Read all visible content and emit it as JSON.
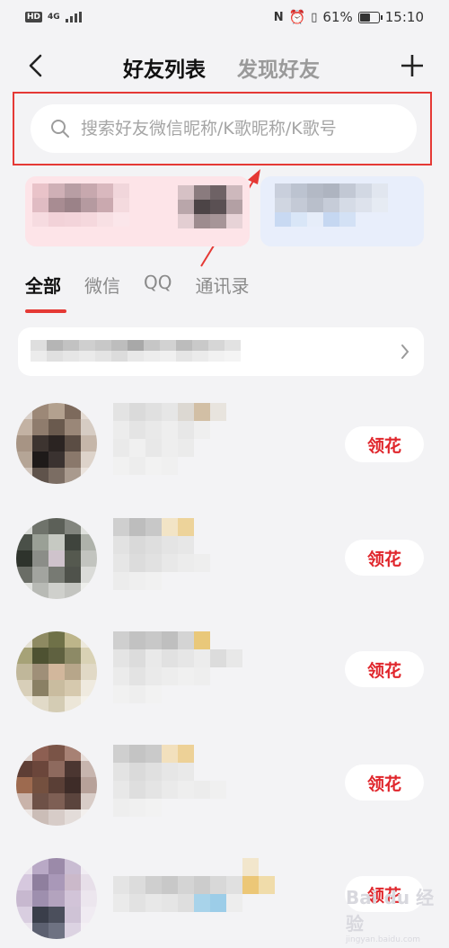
{
  "status_bar": {
    "network": "4G",
    "battery_percent": "61%",
    "battery_level": 0.61,
    "time": "15:10"
  },
  "nav": {
    "tab_friend_list": "好友列表",
    "tab_discover": "发现好友"
  },
  "search": {
    "placeholder": "搜索好友微信昵称/K歌昵称/K歌号"
  },
  "filter_tabs": [
    "全部",
    "微信",
    "QQ",
    "通讯录"
  ],
  "friends": [
    {
      "action": "领花"
    },
    {
      "action": "领花"
    },
    {
      "action": "领花"
    },
    {
      "action": "领花"
    },
    {
      "action": "领花"
    }
  ],
  "watermark": {
    "brand": "Bai du 经验",
    "url": "jingyan.baidu.com"
  },
  "colors": {
    "accent": "#e53935",
    "background": "#f3f3f5",
    "card_pink": "#fde4e8",
    "card_blue": "#e8eefb"
  }
}
